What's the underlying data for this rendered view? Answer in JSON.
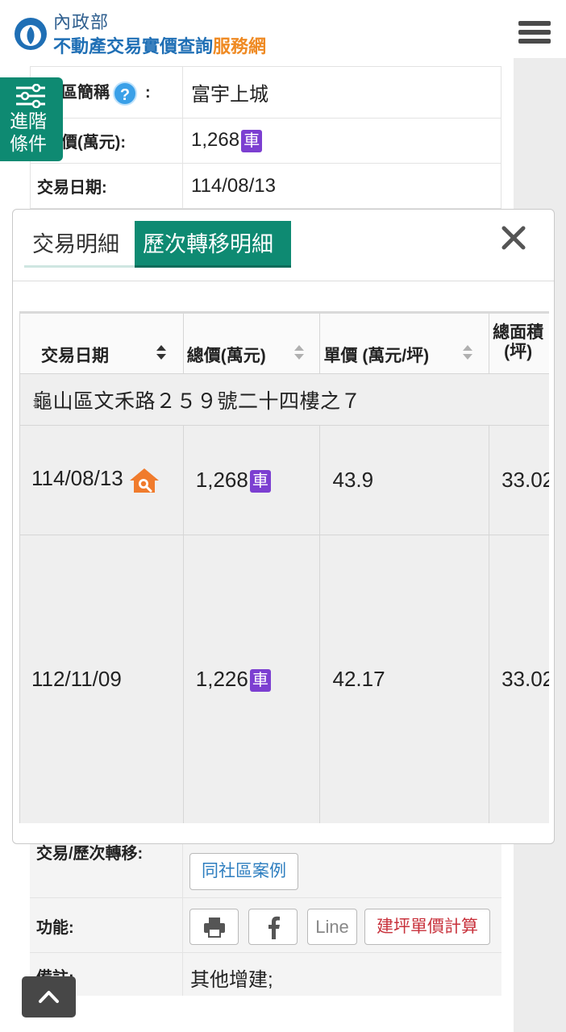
{
  "header": {
    "ministry": "內政部",
    "site_name_main": "不動產交易實價查詢",
    "site_name_accent": "服務網"
  },
  "advanced_filter": {
    "label_line1": "進階",
    "label_line2": "條件"
  },
  "background_detail": {
    "community_label": "社區簡稱",
    "community_label_visible": "區簡稱",
    "community_colon": ":",
    "community_value": "富宇上城",
    "total_label_visible": "價(萬元):",
    "total_value": "1,268",
    "car_badge": "車",
    "date_label": "交易日期:",
    "date_value": "114/08/13",
    "transfer_label": "交易/歷次轉移:",
    "same_community_button": "同社區案例",
    "functions_label": "功能:",
    "line_button": "Line",
    "calc_button": "建坪單價計算",
    "notes_label": "備註:",
    "notes_value": "其他增建;"
  },
  "modal": {
    "tabs": [
      {
        "label": "交易明細",
        "active": false
      },
      {
        "label": "歷次轉移明細",
        "active": true
      }
    ],
    "columns": [
      {
        "label": "交易日期",
        "sort": "active"
      },
      {
        "label": "總價(萬元)",
        "sort": "none"
      },
      {
        "label": "單價 (萬元/坪)",
        "sort": "none"
      },
      {
        "label_line1": "總面積",
        "label_line2": "(坪)"
      }
    ],
    "address": "龜山區文禾路２５９號二十四樓之７",
    "rows": [
      {
        "date": "114/08/13",
        "has_house_icon": true,
        "total": "1,268",
        "car": "車",
        "unit_price": "43.9",
        "area": "33.02"
      },
      {
        "date": "112/11/09",
        "has_house_icon": false,
        "total": "1,226",
        "car": "車",
        "unit_price": "42.17",
        "area": "33.02"
      }
    ]
  },
  "colors": {
    "teal": "#0e8a72",
    "purple_badge": "#7c3fd1",
    "brand_blue": "#1f6fb5",
    "brand_orange": "#ef8a23",
    "house_icon_orange": "#f07b2c"
  },
  "icons": {
    "logo": "ministry-logo-icon",
    "menu": "hamburger-menu-icon",
    "help": "question-icon",
    "filter": "sliders-icon",
    "close": "close-icon",
    "sort": "sort-icon",
    "house": "house-search-icon",
    "print": "print-icon",
    "facebook": "facebook-icon",
    "back_to_top": "chevron-up-icon"
  }
}
